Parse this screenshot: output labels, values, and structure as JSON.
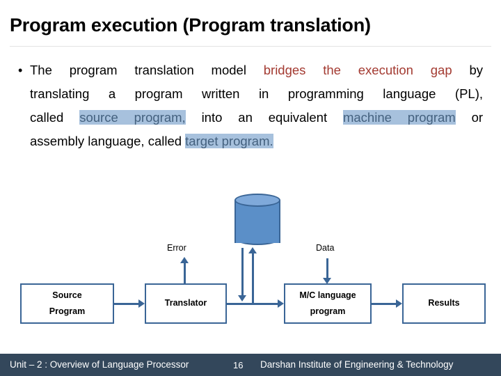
{
  "slide": {
    "title": "Program execution (Program translation)",
    "body": {
      "bullet_marker": "•",
      "lines": [
        {
          "segments": [
            {
              "text": "The program translation model ",
              "style": "plain"
            },
            {
              "text": "bridges the execution gap",
              "style": "red"
            },
            {
              "text": " by",
              "style": "plain"
            }
          ]
        },
        {
          "segments": [
            {
              "text": "translating a program written in programming language (PL),",
              "style": "plain"
            }
          ]
        },
        {
          "segments": [
            {
              "text": "called ",
              "style": "plain"
            },
            {
              "text": "source program,",
              "style": "highlight"
            },
            {
              "text": " into an equivalent ",
              "style": "plain"
            },
            {
              "text": "machine program",
              "style": "highlight"
            },
            {
              "text": " or",
              "style": "plain"
            }
          ]
        },
        {
          "segments": [
            {
              "text": "assembly language, called ",
              "style": "plain"
            },
            {
              "text": "target program.",
              "style": "highlight"
            }
          ]
        }
      ]
    }
  },
  "diagram": {
    "boxes": {
      "source_line1": "Source",
      "source_line2": "Program",
      "translator": "Translator",
      "machine_line1": "M/C language",
      "machine_line2": "program",
      "results": "Results"
    },
    "labels": {
      "error": "Error",
      "data": "Data"
    },
    "database_icon": "cylinder-database"
  },
  "footer": {
    "unit": "Unit – 2 : Overview of Language Processor",
    "page_number": "16",
    "institute": "Darshan Institute of Engineering & Technology"
  },
  "colors": {
    "accent_blue": "#3a6596",
    "cylinder_fill": "#5b8fc8",
    "cylinder_top": "#7fa9da",
    "highlight_bg": "#a7c1dd",
    "highlight_text": "#44617f",
    "red_text": "#a33a31",
    "footer_bg": "#33475b"
  }
}
